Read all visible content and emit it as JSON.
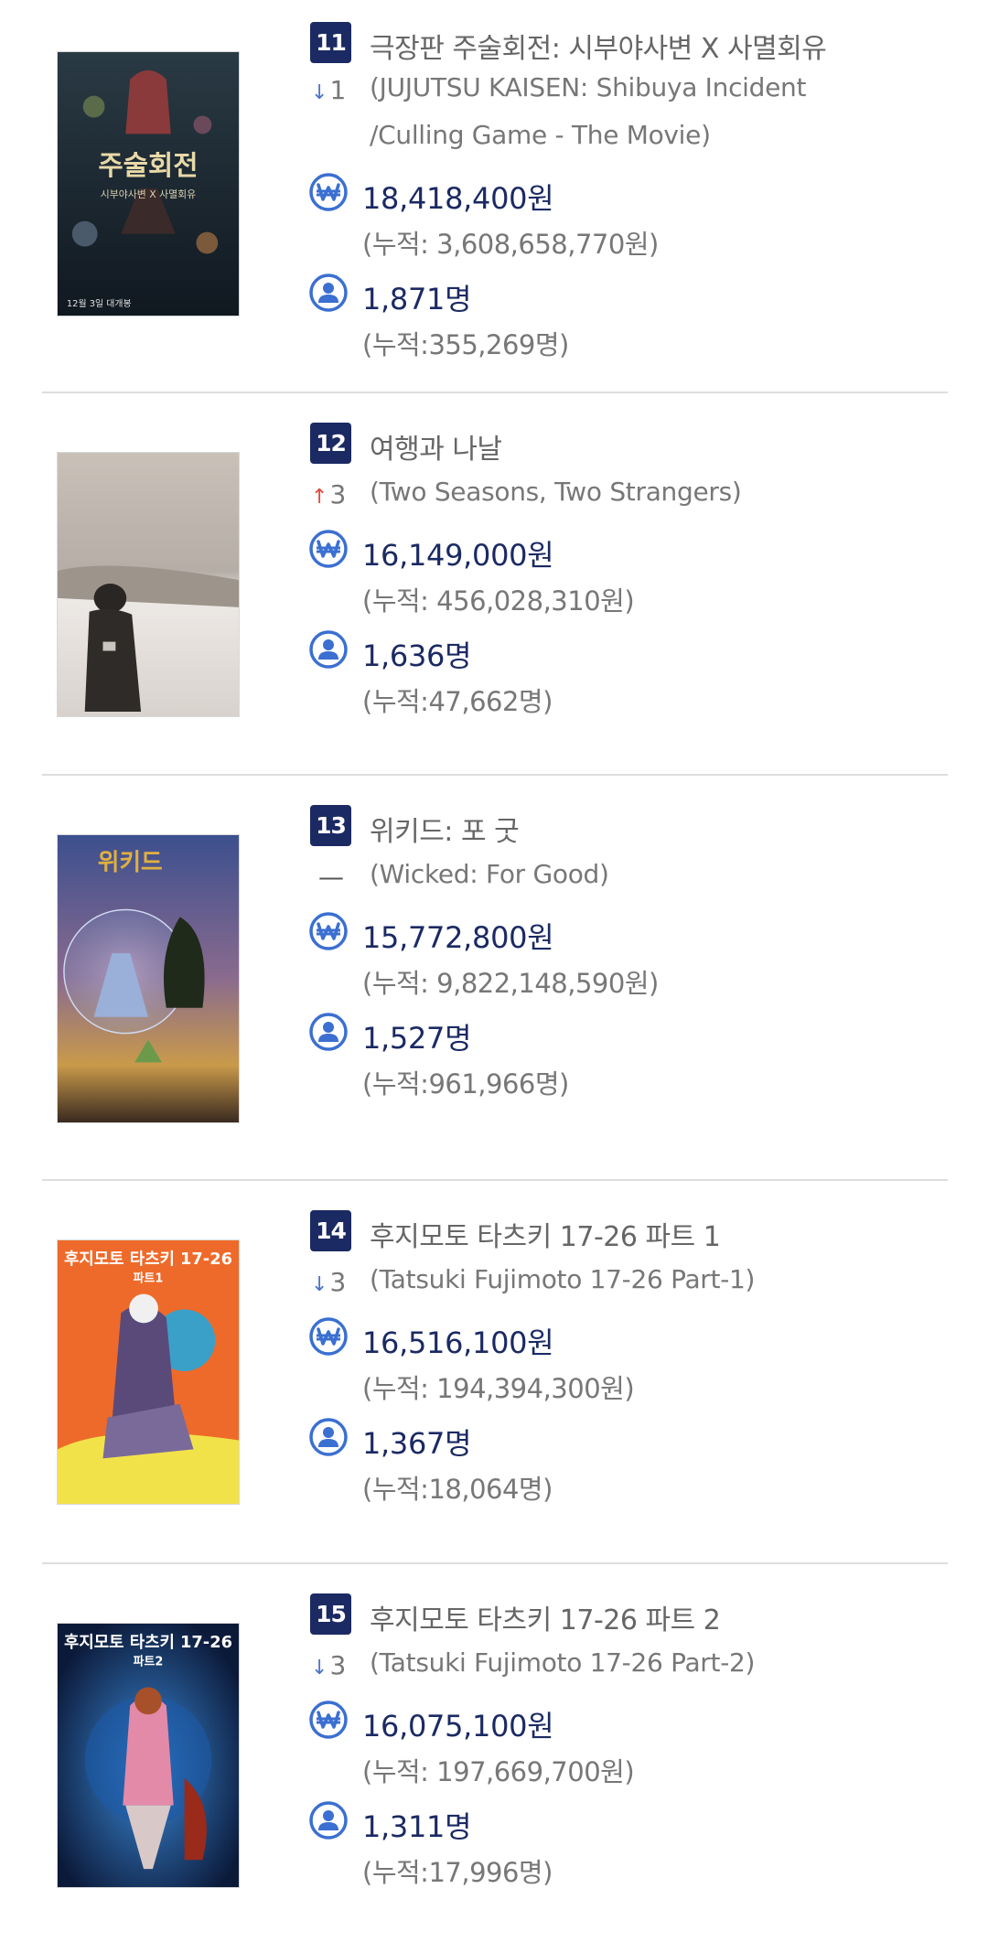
{
  "labels": {
    "sales_icon": "won-icon",
    "audience_icon": "person-icon"
  },
  "colors": {
    "navy": "#1b2a63",
    "icon_blue": "#3b6fd1",
    "arrow_down": "#4d74c9",
    "arrow_up": "#e04a3c",
    "gray_text": "#777777"
  },
  "movies": [
    {
      "rank": "11",
      "change": {
        "direction": "down",
        "amount": "1"
      },
      "title_ko": "극장판 주술회전: 시부야사변 X 사멸회유",
      "title_en": "(JUJUTSU KAISEN: Shibuya Incident /Culling Game - The Movie)",
      "sales": "18,418,400원",
      "sales_cum": "(누적: 3,608,658,770원)",
      "audience": "1,871명",
      "audience_cum": "(누적:355,269명)",
      "poster_text": [
        "주술회전",
        "시부야사변 X 사멸회유",
        "12월 3일 대개봉"
      ]
    },
    {
      "rank": "12",
      "change": {
        "direction": "up",
        "amount": "3"
      },
      "title_ko": "여행과 나날",
      "title_en": "(Two Seasons, Two Strangers)",
      "sales": "16,149,000원",
      "sales_cum": "(누적: 456,028,310원)",
      "audience": "1,636명",
      "audience_cum": "(누적:47,662명)",
      "poster_text": []
    },
    {
      "rank": "13",
      "change": {
        "direction": "same",
        "amount": ""
      },
      "title_ko": "위키드: 포 굿",
      "title_en": "(Wicked: For Good)",
      "sales": "15,772,800원",
      "sales_cum": "(누적: 9,822,148,590원)",
      "audience": "1,527명",
      "audience_cum": "(누적:961,966명)",
      "poster_text": [
        "위키드"
      ]
    },
    {
      "rank": "14",
      "change": {
        "direction": "down",
        "amount": "3"
      },
      "title_ko": "후지모토 타츠키 17-26 파트 1",
      "title_en": "(Tatsuki Fujimoto 17-26 Part-1)",
      "sales": "16,516,100원",
      "sales_cum": "(누적: 194,394,300원)",
      "audience": "1,367명",
      "audience_cum": "(누적:18,064명)",
      "poster_text": [
        "후지모토 타츠키 17-26",
        "파트1"
      ]
    },
    {
      "rank": "15",
      "change": {
        "direction": "down",
        "amount": "3"
      },
      "title_ko": "후지모토 타츠키 17-26 파트 2",
      "title_en": "(Tatsuki Fujimoto 17-26 Part-2)",
      "sales": "16,075,100원",
      "sales_cum": "(누적: 197,669,700원)",
      "audience": "1,311명",
      "audience_cum": "(누적:17,996명)",
      "poster_text": [
        "후지모토 타츠키 17-26",
        "파트2"
      ]
    }
  ]
}
